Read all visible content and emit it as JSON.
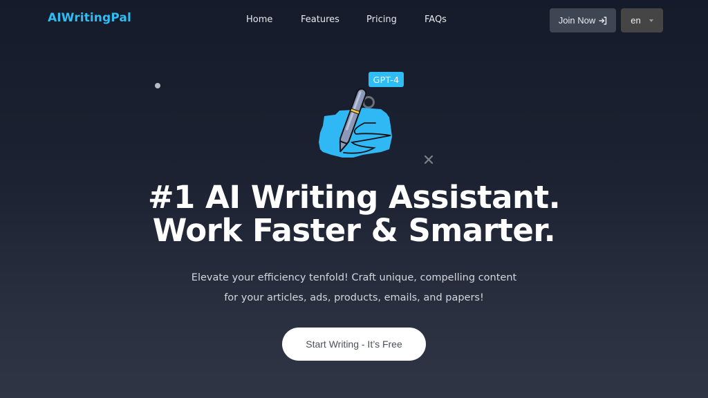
{
  "navbar": {
    "logo": "AIWritingPal",
    "links": [
      {
        "label": "Home"
      },
      {
        "label": "Features"
      },
      {
        "label": "Pricing"
      },
      {
        "label": "FAQs"
      }
    ],
    "join_button": {
      "label": "Join Now",
      "icon": "sign-in-icon"
    },
    "language_select": {
      "selected": "en",
      "icon": "caret-down-icon"
    }
  },
  "hero": {
    "badge": "GPT-4",
    "illustration": "pen-writing-icon",
    "decorations": [
      "dot-icon",
      "ring-icon",
      "x-icon"
    ],
    "headline_line1": "#1 AI Writing Assistant.",
    "headline_line2": "Work Faster & Smarter.",
    "subtext_line1": "Elevate your efficiency tenfold! Craft unique, compelling content",
    "subtext_line2": "for your articles, ads, products, emails, and papers!",
    "cta_label": "Start Writing - It’s Free"
  },
  "colors": {
    "brand": "#2ebdf5",
    "background_top": "#151b2a",
    "background_bottom": "#2f3544",
    "join_button_bg": "#3e4553",
    "language_button_bg": "#454545",
    "cta_bg": "#ffffff"
  }
}
